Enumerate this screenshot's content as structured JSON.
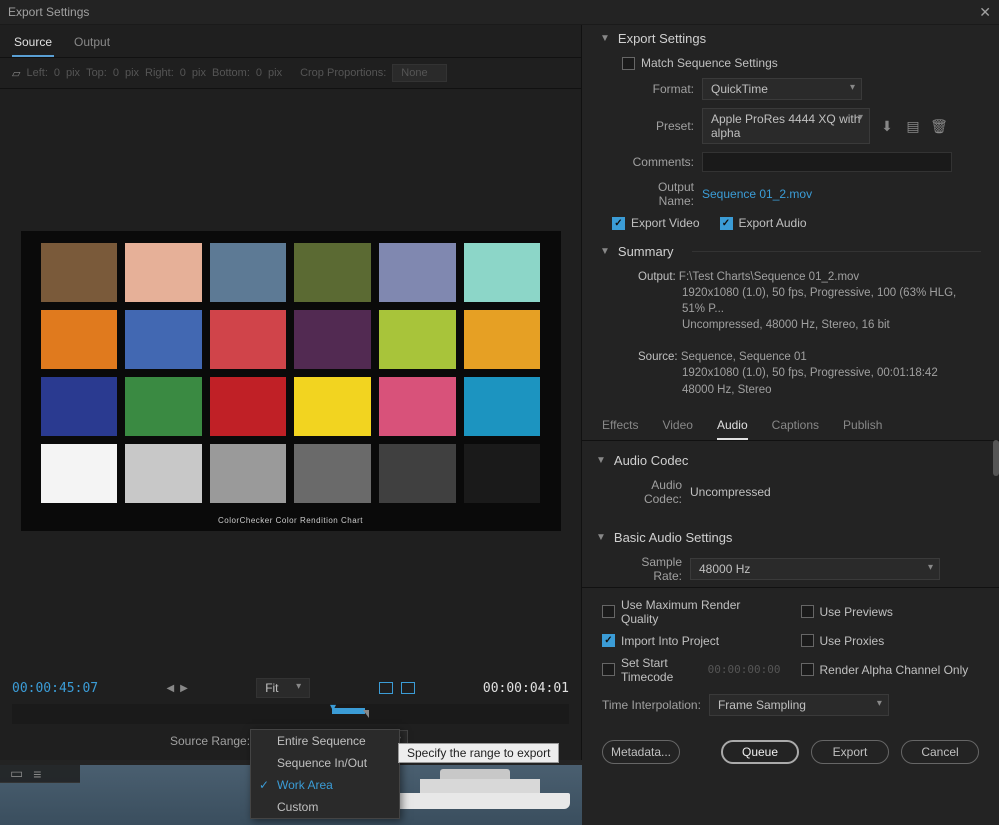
{
  "window": {
    "title": "Export Settings"
  },
  "left_tabs": {
    "source": "Source",
    "output": "Output"
  },
  "crop": {
    "left_lbl": "Left:",
    "left_val": "0",
    "pix": "pix",
    "top_lbl": "Top:",
    "top_val": "0",
    "right_lbl": "Right:",
    "right_val": "0",
    "bottom_lbl": "Bottom:",
    "bottom_val": "0",
    "proportions_lbl": "Crop Proportions:",
    "proportions_val": "None"
  },
  "chart": {
    "caption": "ColorChecker Color Rendition Chart"
  },
  "timeline": {
    "in_tc": "00:00:45:07",
    "out_tc": "00:00:04:01",
    "fit": "Fit",
    "source_range_lbl": "Source Range:",
    "source_range_val": "Work Area",
    "menu": [
      "Entire Sequence",
      "Sequence In/Out",
      "Work Area",
      "Custom"
    ],
    "tooltip": "Specify the range to export"
  },
  "export": {
    "header": "Export Settings",
    "match_seq": "Match Sequence Settings",
    "format_lbl": "Format:",
    "format_val": "QuickTime",
    "preset_lbl": "Preset:",
    "preset_val": "Apple ProRes 4444 XQ with alpha",
    "comments_lbl": "Comments:",
    "output_name_lbl": "Output Name:",
    "output_name_val": "Sequence 01_2.mov",
    "export_video": "Export Video",
    "export_audio": "Export Audio"
  },
  "summary": {
    "header": "Summary",
    "output_k": "Output:",
    "output_l1": "F:\\Test Charts\\Sequence 01_2.mov",
    "output_l2": "1920x1080 (1.0), 50 fps, Progressive, 100 (63% HLG, 51% P...",
    "output_l3": "Uncompressed, 48000 Hz, Stereo, 16 bit",
    "source_k": "Source:",
    "source_l1": "Sequence, Sequence 01",
    "source_l2": "1920x1080 (1.0), 50 fps, Progressive, 00:01:18:42",
    "source_l3": "48000 Hz, Stereo"
  },
  "r_tabs": [
    "Effects",
    "Video",
    "Audio",
    "Captions",
    "Publish"
  ],
  "audio": {
    "codec_header": "Audio Codec",
    "codec_lbl": "Audio Codec:",
    "codec_val": "Uncompressed",
    "basic_header": "Basic Audio Settings",
    "sample_lbl": "Sample Rate:",
    "sample_val": "48000 Hz"
  },
  "render": {
    "max_quality": "Use Maximum Render Quality",
    "previews": "Use Previews",
    "import_project": "Import Into Project",
    "proxies": "Use Proxies",
    "start_tc": "Set Start Timecode",
    "start_tc_val": "00:00:00:00",
    "alpha": "Render Alpha Channel Only",
    "ti_lbl": "Time Interpolation:",
    "ti_val": "Frame Sampling"
  },
  "buttons": {
    "metadata": "Metadata...",
    "queue": "Queue",
    "export": "Export",
    "cancel": "Cancel"
  },
  "swatches": [
    "#7a5a3a",
    "#e6b098",
    "#5d7a95",
    "#5b6a33",
    "#8088b0",
    "#8cd6c8",
    "#e07a1e",
    "#4268b2",
    "#d0444a",
    "#522a52",
    "#a8c43a",
    "#e6a024",
    "#2a3a90",
    "#3a8a42",
    "#c02026",
    "#f2d420",
    "#d8527a",
    "#1c94c0",
    "#f4f4f4",
    "#c8c8c8",
    "#9a9a9a",
    "#6a6a6a",
    "#404040",
    "#1a1a1a"
  ]
}
